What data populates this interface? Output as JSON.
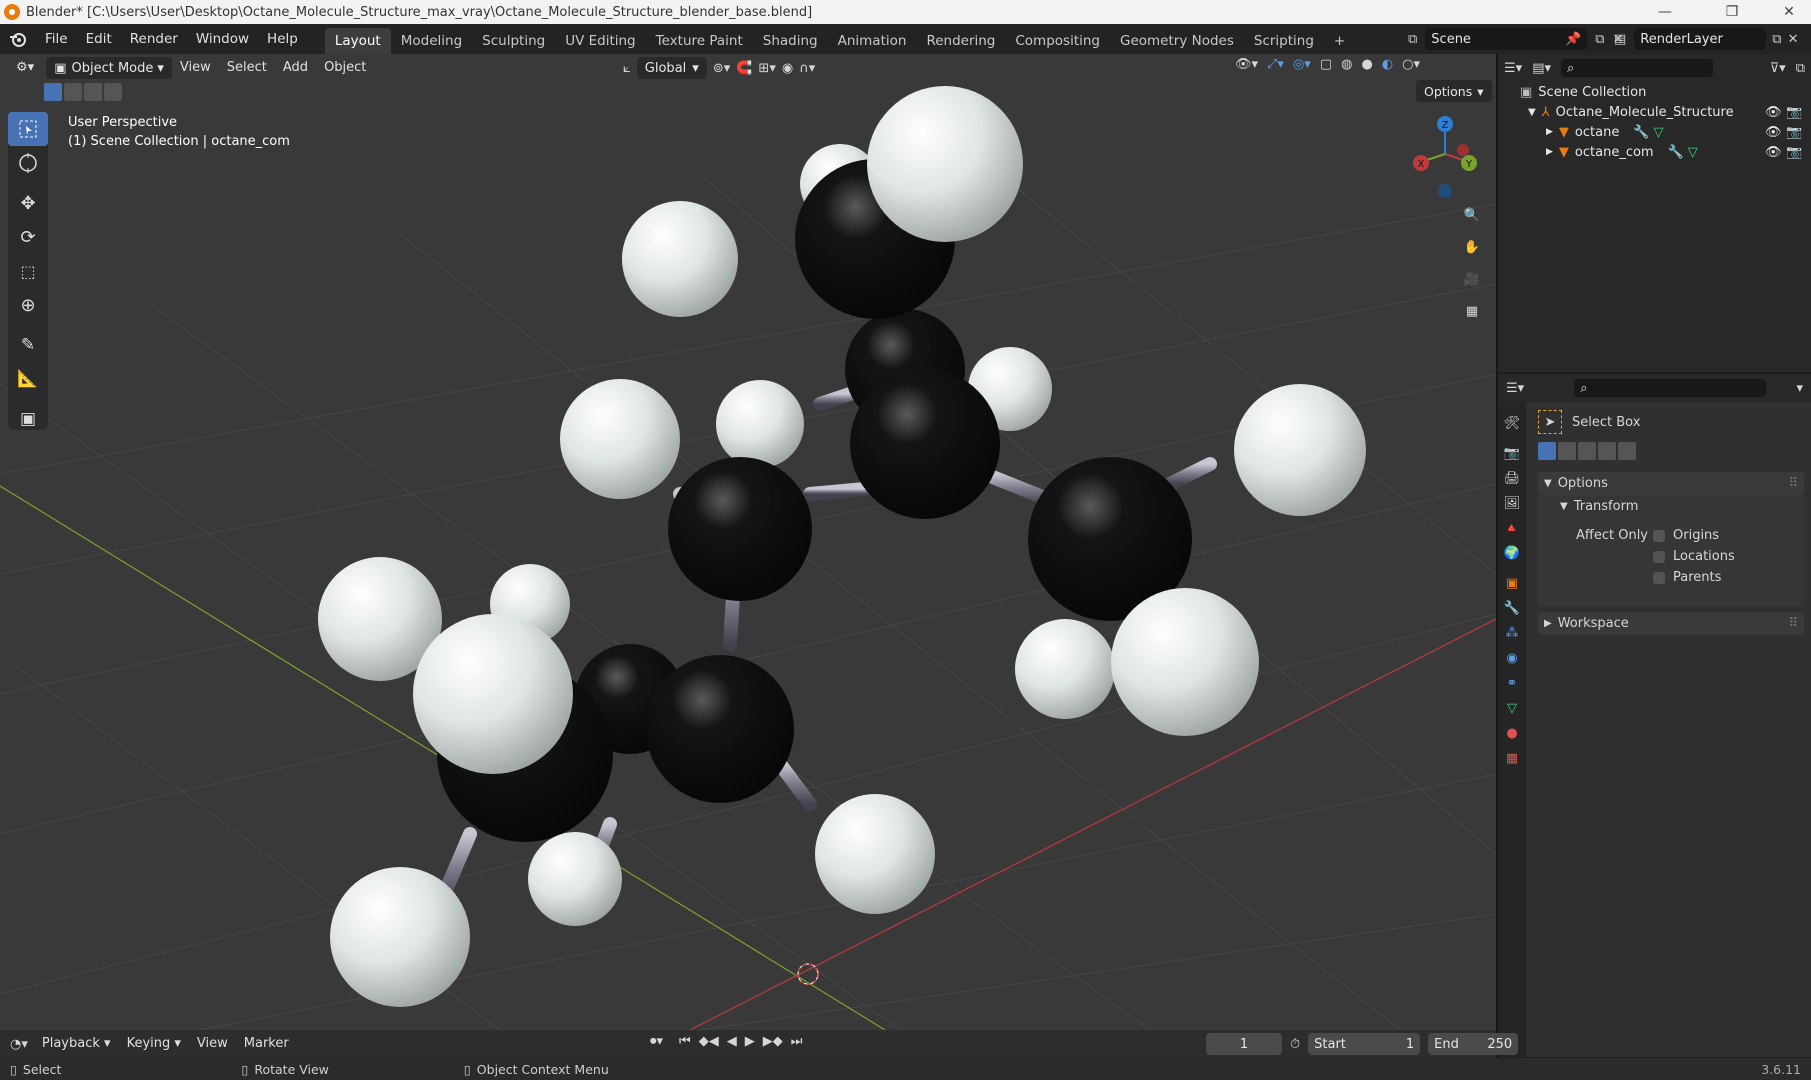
{
  "window": {
    "title": "Blender* [C:\\Users\\User\\Desktop\\Octane_Molecule_Structure_max_vray\\Octane_Molecule_Structure_blender_base.blend]",
    "minimize": "—",
    "maximize": "❐",
    "close": "✕"
  },
  "menu": [
    "File",
    "Edit",
    "Render",
    "Window",
    "Help"
  ],
  "workspaces": [
    "Layout",
    "Modeling",
    "Sculpting",
    "UV Editing",
    "Texture Paint",
    "Shading",
    "Animation",
    "Rendering",
    "Compositing",
    "Geometry Nodes",
    "Scripting"
  ],
  "workspace_add": "+",
  "scene": {
    "label": "Scene",
    "render_layer": "RenderLayer"
  },
  "viewport": {
    "mode": "Object Mode",
    "menus": [
      "View",
      "Select",
      "Add",
      "Object"
    ],
    "transform_orientation": "Global",
    "options_label": "Options",
    "perspective_label": "User Perspective",
    "collection_label": "(1) Scene Collection | octane_com",
    "gizmo": {
      "x": "X",
      "y": "Y",
      "z": "Z"
    }
  },
  "outliner": {
    "root": "Scene Collection",
    "items": [
      {
        "name": "Octane_Molecule_Structure"
      },
      {
        "name": "octane"
      },
      {
        "name": "octane_com"
      }
    ]
  },
  "properties": {
    "tool_name": "Select Box",
    "options_panel": "Options",
    "transform_panel": "Transform",
    "affect_only_label": "Affect Only",
    "checkboxes": [
      "Origins",
      "Locations",
      "Parents"
    ],
    "workspace_panel": "Workspace"
  },
  "timeline": {
    "menus": [
      "Playback",
      "Keying",
      "View",
      "Marker"
    ],
    "current_frame": "1",
    "start_label": "Start",
    "start": "1",
    "end_label": "End",
    "end": "250"
  },
  "statusbar": {
    "select": "Select",
    "rotate": "Rotate View",
    "context": "Object Context Menu",
    "version": "3.6.11"
  },
  "colors": {
    "accent": "#4772b3",
    "orange": "#e87d0d",
    "viewport_bg": "#3a3a3a",
    "axis_x": "#c0393b",
    "axis_y": "#7aa32b",
    "axis_z": "#2d7fd3"
  }
}
